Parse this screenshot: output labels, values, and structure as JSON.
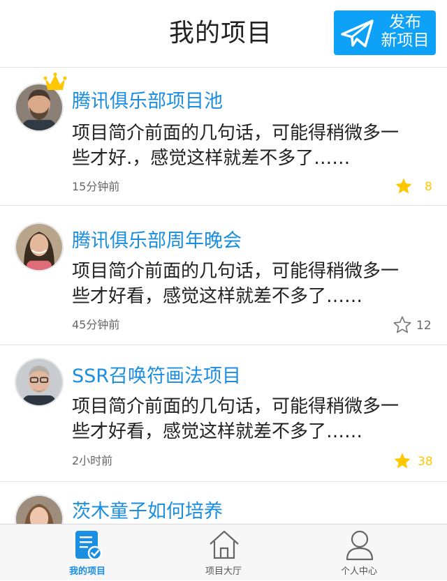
{
  "header": {
    "title": "我的项目",
    "publish_line1": "发布",
    "publish_line2": "新项目"
  },
  "items": [
    {
      "title": "腾讯俱乐部项目池",
      "desc_line1": "项目简介前面的几句话，可能得稍微多一",
      "desc_line2": "些才好.，感觉这样就差不多了……",
      "time": "15分钟前",
      "starred": true,
      "count": "8",
      "crown": true,
      "avatar": "man-beard"
    },
    {
      "title": "腾讯俱乐部周年晚会",
      "desc_line1": "项目简介前面的几句话，可能得稍微多一",
      "desc_line2": "些才好看，感觉这样就差不多了……",
      "time": "45分钟前",
      "starred": false,
      "count": "12",
      "crown": false,
      "avatar": "woman-dark-hair"
    },
    {
      "title": "SSR召唤符画法项目",
      "desc_line1": "项目简介前面的几句话，可能得稍微多一",
      "desc_line2": "些才好看，感觉这样就差不多了……",
      "time": "2小时前",
      "starred": true,
      "count": "38",
      "crown": false,
      "avatar": "man-glasses"
    },
    {
      "title": "茨木童子如何培养",
      "avatar": "woman-brown-hair"
    }
  ],
  "tabs": [
    {
      "label": "我的项目",
      "icon": "document-check-icon",
      "active": true
    },
    {
      "label": "项目大厅",
      "icon": "home-icon",
      "active": false
    },
    {
      "label": "个人中心",
      "icon": "user-icon",
      "active": false
    }
  ],
  "colors": {
    "accent": "#1a8ee0",
    "button": "#0da2f7",
    "star_filled": "#ffc700",
    "star_empty": "#777777"
  }
}
